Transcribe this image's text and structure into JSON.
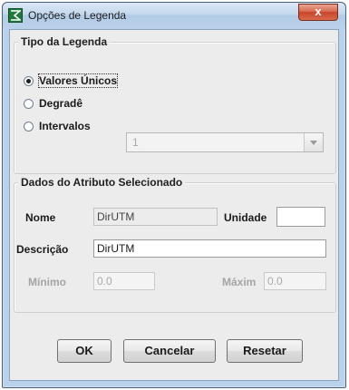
{
  "window": {
    "title": "Opções de Legenda",
    "close_label": "x"
  },
  "legend_type": {
    "title": "Tipo da Legenda",
    "options": [
      {
        "label": "Valores Únicos",
        "checked": true
      },
      {
        "label": "Degradê",
        "checked": false
      },
      {
        "label": "Intervalos",
        "checked": false
      }
    ],
    "intervals_value": "1"
  },
  "attribute": {
    "title": "Dados do Atributo Selecionado",
    "name_label": "Nome",
    "name_value": "DirUTM",
    "unit_label": "Unidade",
    "unit_value": "",
    "description_label": "Descrição",
    "description_value": "DirUTM",
    "min_label": "Mínimo",
    "min_value": "0.0",
    "max_label": "Máxim",
    "max_value": "0.0"
  },
  "buttons": {
    "ok": "OK",
    "cancel": "Cancelar",
    "reset": "Resetar"
  }
}
